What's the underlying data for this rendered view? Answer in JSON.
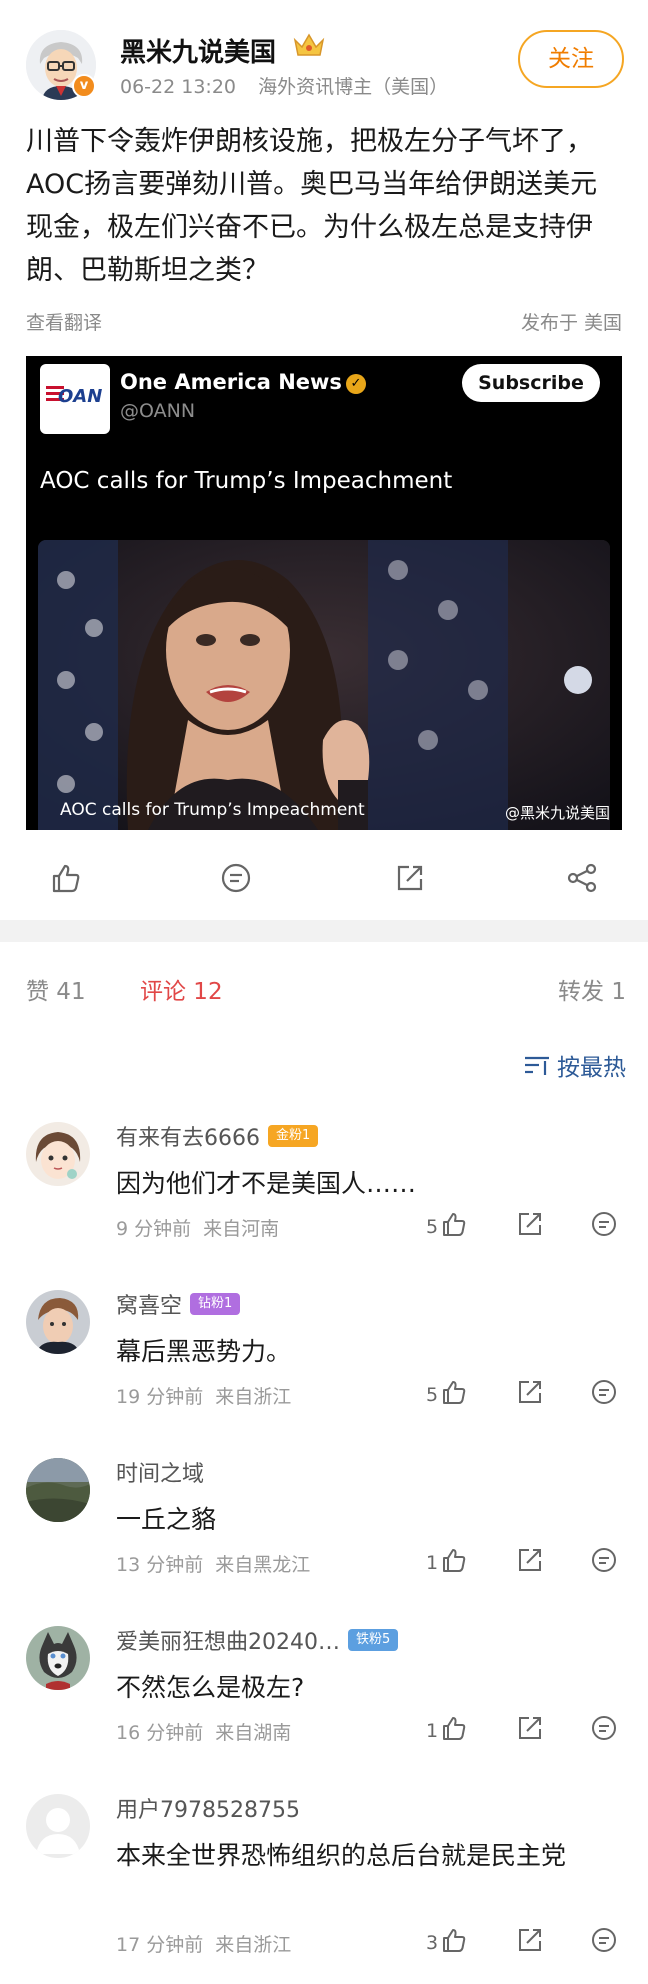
{
  "post": {
    "author": "黑米九说美国",
    "time": "06-22 13:20",
    "source": "海外资讯博主（美国）",
    "follow_label": "关注",
    "text": "川普下令轰炸伊朗核设施，把极左分子气坏了，AOC扬言要弹劾川普。奥巴马当年给伊朗送美元现金，极左们兴奋不已。为什么极左总是支持伊朗、巴勒斯坦之类？",
    "translate_label": "查看翻译",
    "origin_label": "发布于 美国",
    "card": {
      "logo_text": "OAN",
      "channel_name": "One America News",
      "channel_handle": "@OANN",
      "subscribe_label": "Subscribe",
      "headline": "AOC calls for Trump’s Impeachment",
      "caption": "AOC calls for Trump’s Impeachment",
      "watermark": "@黑米九说美国"
    }
  },
  "tabs": {
    "likes": "赞 41",
    "comments": "评论 12",
    "reposts": "转发 1"
  },
  "sort_label": "按最热",
  "comments": [
    {
      "user": "有来有去6666",
      "badge": "金粉1",
      "text": "因为他们才不是美国人……",
      "time": "9 分钟前",
      "location": "来自河南",
      "likes": "5"
    },
    {
      "user": "窝喜空",
      "badge": "钻粉1",
      "text": "幕后黑恶势力。",
      "time": "19 分钟前",
      "location": "来自浙江",
      "likes": "5"
    },
    {
      "user": "时间之域",
      "badge": "",
      "text": "一丘之貉",
      "time": "13 分钟前",
      "location": "来自黑龙江",
      "likes": "1"
    },
    {
      "user": "爱美丽狂想曲20240…",
      "badge": "铁粉5",
      "text": "不然怎么是极左?",
      "time": "16 分钟前",
      "location": "来自湖南",
      "likes": "1"
    },
    {
      "user": "用户7978528755",
      "badge": "",
      "text": "本来全世界恐怖组织的总后台就是民主党",
      "time": "17 分钟前",
      "location": "来自浙江",
      "likes": "3"
    }
  ],
  "colors": {
    "accent_orange": "#f07d00",
    "active_tab_red": "#e14747",
    "link_blue": "#2d5a97"
  }
}
